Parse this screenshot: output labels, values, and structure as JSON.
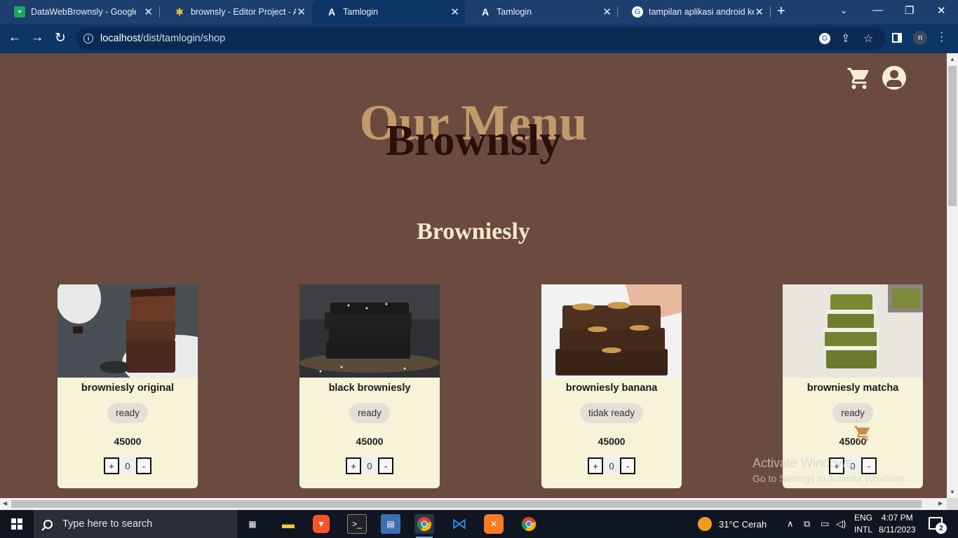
{
  "browser": {
    "tabs": [
      {
        "title": "DataWebBrownsly - Google S",
        "icon": "google-sheets-icon"
      },
      {
        "title": "brownsly - Editor Project - Ap",
        "icon": "project-editor-icon"
      },
      {
        "title": "Tamlogin",
        "icon": "angular-icon",
        "active": true
      },
      {
        "title": "Tamlogin",
        "icon": "angular-icon"
      },
      {
        "title": "tampilan aplikasi android ke",
        "icon": "google-icon"
      }
    ],
    "url_host": "localhost",
    "url_path": "/dist/tamlogin/shop",
    "profile_initial": "n"
  },
  "page": {
    "title": "Our Menu",
    "brand": "Brownsly",
    "section_title": "Browniesly",
    "products": [
      {
        "name": "browniesly original",
        "status": "ready",
        "price": "45000",
        "qty": "0",
        "plus": "+",
        "minus": "-"
      },
      {
        "name": "black browniesly",
        "status": "ready",
        "price": "45000",
        "qty": "0",
        "plus": "+",
        "minus": "-"
      },
      {
        "name": "browniesly banana",
        "status": "tidak ready",
        "price": "45000",
        "qty": "0",
        "plus": "+",
        "minus": "-"
      },
      {
        "name": "browniesly matcha",
        "status": "ready",
        "price": "45000",
        "qty": "0",
        "plus": "+",
        "minus": "-"
      }
    ],
    "watermark": {
      "line1": "Activate Windows",
      "line2": "Go to Settings to activate Windows."
    }
  },
  "taskbar": {
    "search_placeholder": "Type here to search",
    "weather": "31°C  Cerah",
    "lang_1": "ENG",
    "lang_2": "INTL",
    "time": "4:07 PM",
    "date": "8/11/2023",
    "notification_count": "2"
  },
  "colors": {
    "page_bg": "#6b4a3f",
    "title_gold": "#c39a6b",
    "brand_dark": "#2a0f0d",
    "card_bg": "#f6f3d9",
    "browser_blue": "#0d3566"
  }
}
